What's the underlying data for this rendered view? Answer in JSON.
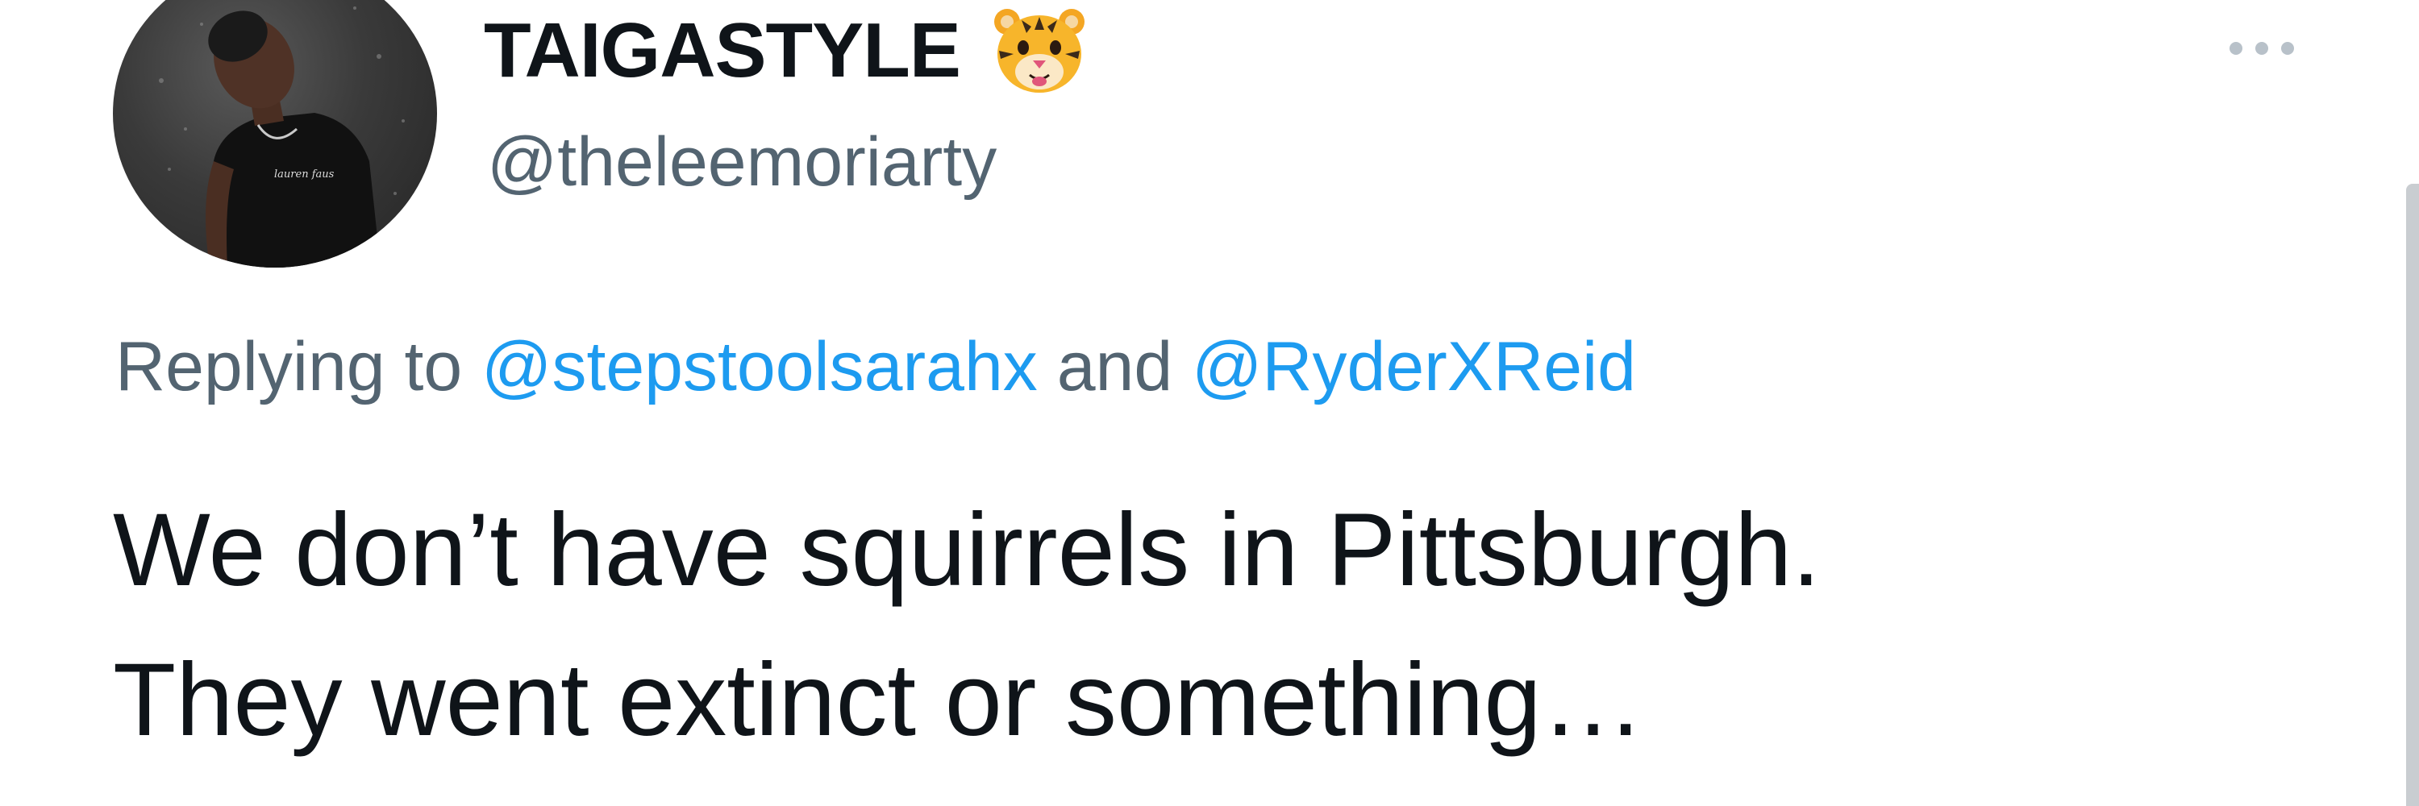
{
  "author": {
    "display_name": "TAIGASTYLE",
    "badge_icon": "tiger-face-icon",
    "handle": "@theleemoriarty",
    "avatar": "user-avatar-photo"
  },
  "reply": {
    "prefix": "Replying to ",
    "mention_1": "@stepstoolsarahx",
    "conjunction": " and ",
    "mention_2": "@RyderXReid"
  },
  "tweet": {
    "line_1": "We don’t have squirrels in Pittsburgh.",
    "line_2": "They went extinct or something…"
  },
  "more_icon": "more-options-icon",
  "colors": {
    "text": "#0f1419",
    "secondary_text": "#536471",
    "link": "#1d9bf0"
  }
}
